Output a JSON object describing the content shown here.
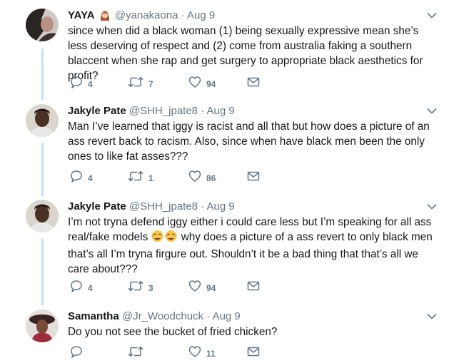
{
  "tweets": [
    {
      "name": "YAYA",
      "handle": "@yanakaona",
      "dot": "·",
      "date": "Aug 9",
      "badge": "woman-emoji",
      "text": "since when did a black woman (1) being sexually expressive mean she’s less deserving of respect and (2) come from australia faking a southern blaccent when she rap and get surgery to appropriate black aesthetics for profit?",
      "replies": "4",
      "retweets": "7",
      "likes": "94"
    },
    {
      "name": "Jakyle Pate",
      "handle": "@SHH_jpate8",
      "dot": "·",
      "date": "Aug 9",
      "text": "Man I’ve learned that iggy is racist and all that but how does a picture of an ass revert back to racism. Also, since when have black men been the only ones to like fat asses???",
      "replies": "4",
      "retweets": "1",
      "likes": "86"
    },
    {
      "name": "Jakyle Pate",
      "handle": "@SHH_jpate8",
      "dot": "·",
      "date": "Aug 9",
      "text_a": "I’m not tryna defend iggy either i could care less but I’m speaking for all ass real/fake models",
      "emoji": "face-with-tears-of-joy x2",
      "text_b": " why does a picture of a ass revert to only black men that’s all I’m tryna firgure out. Shouldn’t it be a bad thing that that’s all we care about???",
      "replies": "4",
      "retweets": "3",
      "likes": "94"
    },
    {
      "name": "Samantha",
      "handle": "@Jr_Woodchuck",
      "dot": "·",
      "date": "Aug 9",
      "text": "Do you not see the bucket of fried chicken?",
      "replies": "",
      "retweets": "",
      "likes": "11"
    }
  ],
  "colors": {
    "thread_line": "#c4e2f6",
    "muted": "#657786",
    "text": "#14171a"
  }
}
